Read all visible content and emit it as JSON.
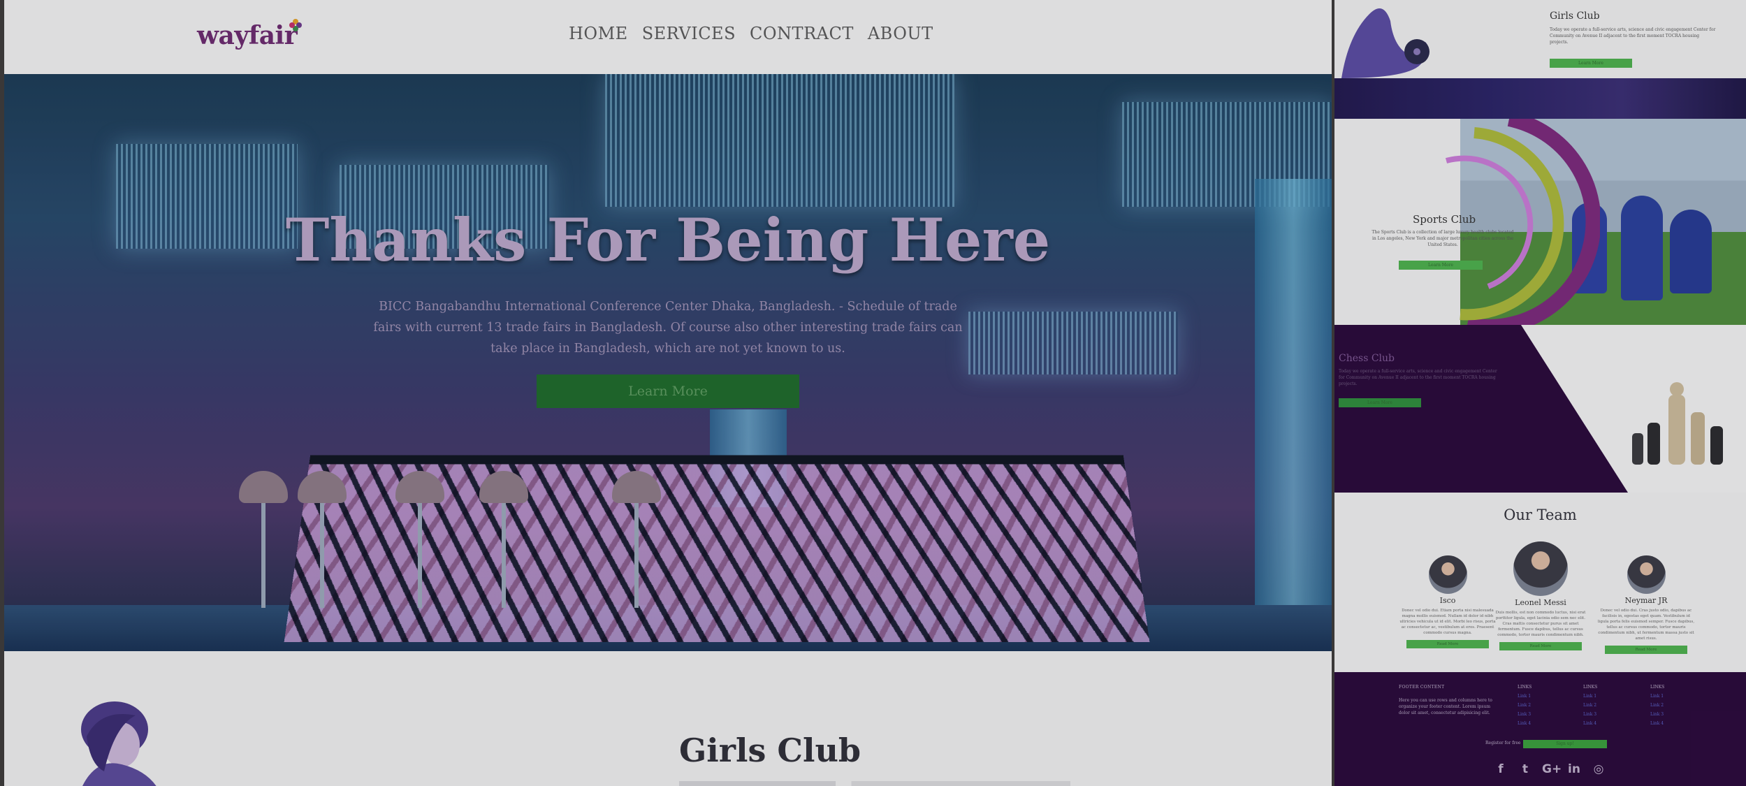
{
  "brand": {
    "logo_text": "wayfair"
  },
  "nav": {
    "items": [
      "HOME",
      "SERVICES",
      "CONTRACT",
      "ABOUT"
    ]
  },
  "hero": {
    "title": "Thanks For Being Here",
    "text": "BICC Bangabandhu International Conference Center Dhaka, Bangladesh. - Schedule of trade fairs with current 13 trade fairs in Bangladesh. Of course also other interesting trade fairs can take place in Bangladesh, which are not yet known to us.",
    "button": "Learn More"
  },
  "girls_section": {
    "title": "Girls Club"
  },
  "preview": {
    "girls": {
      "title": "Girls Club",
      "text": "Today we operate a full-service arts, science and civic engagement Center for Community on Avenue II adjacent to the first moment TOCRA housing projects.",
      "button": "Learn More"
    },
    "sports": {
      "title": "Sports Club",
      "text": "The Sports Club is a collection of large luxury health clubs located in Los angeles, New York and major metropolitan cities across the United States.",
      "button": "Learn More"
    },
    "chess": {
      "title": "Chess Club",
      "text": "Today we operate a full-service arts, science and civic engagement Center for Community on Avenue II adjacent to the first moment TOCRA housing projects.",
      "button": "Learn More"
    },
    "team": {
      "title": "Our Team",
      "members": [
        {
          "name": "Isco",
          "text": "Donec vel odio dui. Etiam porta nisi malesuada magna mollis euismod. Nullam id dolor id nibh ultricies vehicula ut id elit. Morbi leo risus, porta ac consectetur ac, vestibulum at eros. Praesent commodo cursus magna.",
          "button": "Read More"
        },
        {
          "name": "Leonel Messi",
          "text": "Duis mollis, est non commodo luctus, nisi erat porttitor ligula, eget lacinia odio sem nec elit. Cras mattis consectetur purus sit amet fermentum. Fusce dapibus, tellus ac cursus commodo, tortor mauris condimentum nibh.",
          "button": "Read More"
        },
        {
          "name": "Neymar JR",
          "text": "Donec vel odio dui. Cras justo odio, dapibus ac facilisis in, egestas eget quam. Vestibulum id ligula porta felis euismod semper. Fusce dapibus, tellus ac cursus commodo, tortor mauris condimentum nibh, ut fermentum massa justo sit amet risus.",
          "button": "Read More"
        }
      ]
    },
    "footer": {
      "title": "FOOTER CONTENT",
      "text": "Here you can use rows and columns here to organize your footer content. Lorem ipsum dolor sit amet, consectetur adipisicing elit.",
      "links_title": "LINKS",
      "links": [
        "Link 1",
        "Link 2",
        "Link 3",
        "Link 4"
      ],
      "register": "Register for free",
      "signup": "Sign up!",
      "social": [
        "f",
        "t",
        "G+",
        "in",
        "◎"
      ]
    }
  },
  "colors": {
    "accent": "#4cae4c",
    "brand": "#6b2b6e",
    "footer_bg": "#2a0a3a"
  }
}
